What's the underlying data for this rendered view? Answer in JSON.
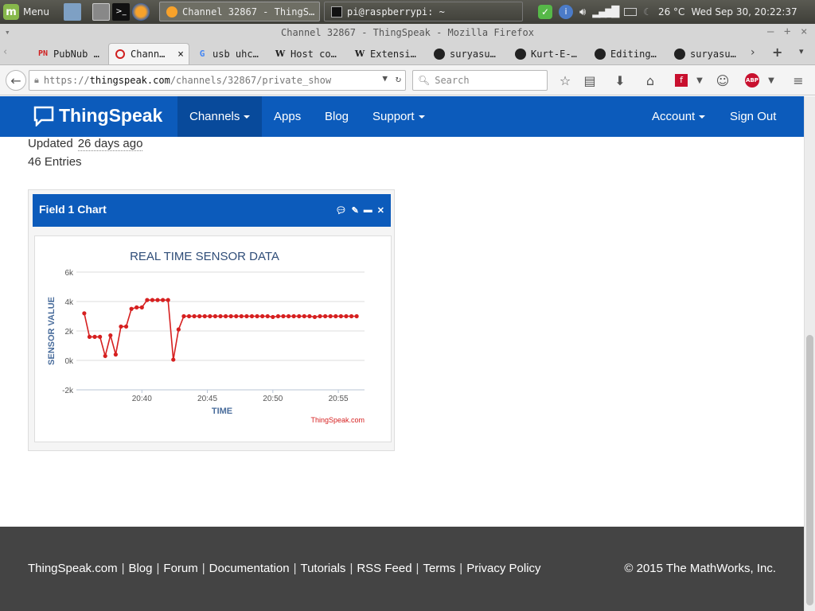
{
  "taskbar": {
    "menu_label": "Menu",
    "tasks": [
      {
        "label": "Channel 32867 - ThingS…",
        "active": true
      },
      {
        "label": "pi@raspberrypi: ~",
        "active": false
      }
    ],
    "temperature": "26 °C",
    "clock": "Wed Sep 30, 20:22:37"
  },
  "window": {
    "title": "Channel 32867 - ThingSpeak - Mozilla Firefox"
  },
  "tabs": [
    {
      "label": "PubNub …",
      "icon": "PN",
      "active": false
    },
    {
      "label": "Chann…",
      "icon": "Q",
      "active": true
    },
    {
      "label": "usb uhc…",
      "icon": "G",
      "active": false
    },
    {
      "label": "Host co…",
      "icon": "W",
      "active": false
    },
    {
      "label": "Extensi…",
      "icon": "W",
      "active": false
    },
    {
      "label": "suryasu…",
      "icon": "github",
      "active": false
    },
    {
      "label": "Kurt-E-…",
      "icon": "github",
      "active": false
    },
    {
      "label": "Editing…",
      "icon": "github",
      "active": false
    },
    {
      "label": "suryasu…",
      "icon": "github",
      "active": false
    }
  ],
  "navbar": {
    "url_prefix": "https://",
    "url_domain": "thingspeak.com",
    "url_path": "/channels/32867/private_show",
    "search_placeholder": "Search"
  },
  "site": {
    "logo_text": "ThingSpeak",
    "nav": {
      "channels": "Channels",
      "apps": "Apps",
      "blog": "Blog",
      "support": "Support",
      "account": "Account",
      "sign_out": "Sign Out"
    }
  },
  "channel": {
    "updated_label": "Updated",
    "updated_value": "26 days ago",
    "entries": "46 Entries"
  },
  "widget": {
    "title": "Field 1 Chart"
  },
  "chart_data": {
    "type": "line",
    "title": "REAL TIME SENSOR DATA",
    "xlabel": "TIME",
    "ylabel": "SENSOR VALUE",
    "credit": "ThingSpeak.com",
    "ylim": [
      -2000,
      6000
    ],
    "yticks": [
      "6k",
      "4k",
      "2k",
      "0k",
      "-2k"
    ],
    "ytick_values": [
      6000,
      4000,
      2000,
      0,
      -2000
    ],
    "xticks": [
      "20:40",
      "20:45",
      "20:50",
      "20:55"
    ],
    "xtick_values": [
      "20:40",
      "20:45",
      "20:50",
      "20:55"
    ],
    "grid": true,
    "color": "#d62020",
    "x": [
      "20:35:36",
      "20:36:00",
      "20:36:24",
      "20:36:48",
      "20:37:12",
      "20:37:36",
      "20:38:00",
      "20:38:24",
      "20:38:48",
      "20:39:12",
      "20:39:36",
      "20:40:00",
      "20:40:24",
      "20:40:48",
      "20:41:12",
      "20:41:36",
      "20:42:00",
      "20:42:24",
      "20:42:48",
      "20:43:12",
      "20:43:36",
      "20:44:00",
      "20:44:24",
      "20:44:48",
      "20:45:12",
      "20:45:36",
      "20:46:00",
      "20:46:24",
      "20:46:48",
      "20:47:12",
      "20:47:36",
      "20:48:00",
      "20:48:24",
      "20:48:48",
      "20:49:12",
      "20:49:36",
      "20:50:00",
      "20:50:24",
      "20:50:48",
      "20:51:12",
      "20:51:36",
      "20:52:00",
      "20:52:24",
      "20:52:48",
      "20:53:12",
      "20:53:36",
      "20:54:00",
      "20:54:24",
      "20:54:48",
      "20:55:12",
      "20:55:36",
      "20:56:00",
      "20:56:24"
    ],
    "values": [
      3200,
      1600,
      1600,
      1600,
      300,
      1700,
      400,
      2300,
      2300,
      3500,
      3600,
      3600,
      4100,
      4100,
      4100,
      4100,
      4100,
      50,
      2100,
      3000,
      3000,
      3000,
      3000,
      3000,
      3000,
      3000,
      3000,
      3000,
      3000,
      3000,
      3000,
      3000,
      3000,
      3000,
      3000,
      3000,
      2950,
      3000,
      3000,
      3000,
      3000,
      3000,
      3000,
      3000,
      2950,
      3000,
      3000,
      3000,
      3000,
      3000,
      3000,
      3000,
      3000
    ]
  }
}
